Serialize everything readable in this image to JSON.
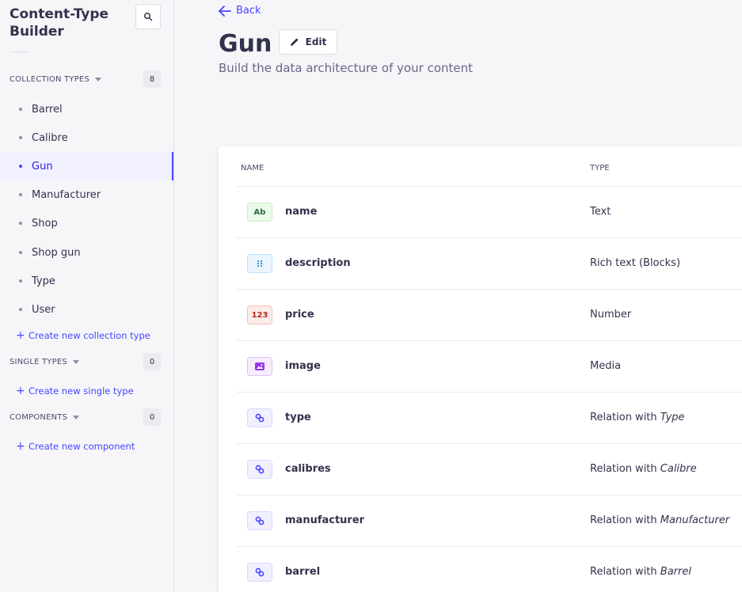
{
  "sidebar": {
    "title": "Content-Type Builder",
    "search_icon": "search-icon",
    "collection_types": {
      "label": "Collection types",
      "count": "8",
      "items": [
        {
          "label": "Barrel"
        },
        {
          "label": "Calibre"
        },
        {
          "label": "Gun"
        },
        {
          "label": "Manufacturer"
        },
        {
          "label": "Shop"
        },
        {
          "label": "Shop gun"
        },
        {
          "label": "Type"
        },
        {
          "label": "User"
        }
      ],
      "active": "Gun",
      "create_label": "Create new collection type"
    },
    "single_types": {
      "label": "Single types",
      "count": "0",
      "create_label": "Create new single type"
    },
    "components": {
      "label": "Components",
      "count": "0",
      "create_label": "Create new component"
    }
  },
  "header": {
    "back_label": "Back",
    "title": "Gun",
    "edit_label": "Edit",
    "subtitle": "Build the data architecture of your content"
  },
  "table": {
    "columns": [
      "Name",
      "Type"
    ],
    "rows": [
      {
        "badge": "Ab",
        "name": "name",
        "type": "Text",
        "icon": "text-icon"
      },
      {
        "badge": "",
        "name": "description",
        "type": "Rich text (Blocks)",
        "icon": "blocks-icon"
      },
      {
        "badge": "123",
        "name": "price",
        "type": "Number",
        "icon": "number-icon"
      },
      {
        "badge": "",
        "name": "image",
        "type": "Media",
        "icon": "media-icon"
      },
      {
        "badge": "",
        "name": "type",
        "type_prefix": "Relation with",
        "type_target": "Type",
        "icon": "relation-icon"
      },
      {
        "badge": "",
        "name": "calibres",
        "type_prefix": "Relation with",
        "type_target": "Calibre",
        "icon": "relation-icon"
      },
      {
        "badge": "",
        "name": "manufacturer",
        "type_prefix": "Relation with",
        "type_target": "Manufacturer",
        "icon": "relation-icon"
      },
      {
        "badge": "",
        "name": "barrel",
        "type_prefix": "Relation with",
        "type_target": "Barrel",
        "icon": "relation-icon"
      }
    ]
  },
  "colors": {
    "primary": "#4945ff",
    "active_bg": "#f0f0ff",
    "text": "#32324d"
  }
}
